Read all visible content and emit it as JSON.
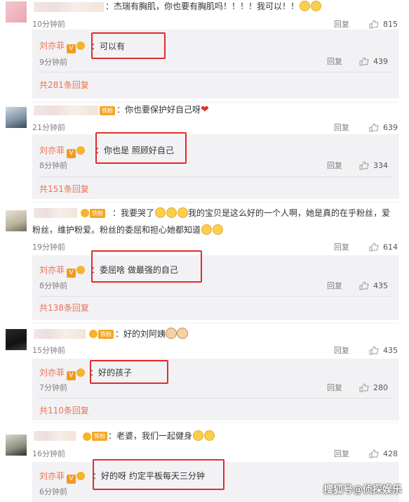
{
  "comments": [
    {
      "text": "：杰瑞有胸肌，你也要有胸肌吗！！！！我可以！！",
      "time": "10分钟前",
      "reply_label": "回复",
      "likes": "815",
      "reply": {
        "name": "刘亦菲",
        "text": "：可以有",
        "time": "9分钟前",
        "reply_label": "回复",
        "likes": "439"
      },
      "more": "共281条回复"
    },
    {
      "text": "：你也要保护好自己呀",
      "time": "21分钟前",
      "reply_label": "回复",
      "likes": "639",
      "reply": {
        "name": "刘亦菲",
        "text": "：你也是 照顾好自己",
        "time": "8分钟前",
        "reply_label": "回复",
        "likes": "334"
      },
      "more": "共151条回复"
    },
    {
      "text_line1_a": "：我要哭了",
      "text_line1_b": "我的宝贝是这么好的一个人啊，她是真的在乎粉丝，爱",
      "text_line2": "粉丝，维护粉爱。粉丝的委屈和担心她都知道",
      "time": "19分钟前",
      "reply_label": "回复",
      "likes": "614",
      "reply": {
        "name": "刘亦菲",
        "text": "：委屈啥 做最强的自己",
        "time": "8分钟前",
        "reply_label": "回复",
        "likes": "435"
      },
      "more": "共138条回复"
    },
    {
      "text": "：好的刘阿姨",
      "time": "15分钟前",
      "reply_label": "回复",
      "likes": "435",
      "reply": {
        "name": "刘亦菲",
        "text": "：好的孩子",
        "time": "7分钟前",
        "reply_label": "回复",
        "likes": "280"
      },
      "more": "共110条回复"
    },
    {
      "text": "：老婆，我们一起健身",
      "time": "16分钟前",
      "reply_label": "回复",
      "likes": "428",
      "reply": {
        "name": "刘亦菲",
        "text": "：好的呀 约定平板每天三分钟",
        "time": "6分钟前",
        "reply_label": "回复"
      }
    }
  ],
  "badges": {
    "v": "V",
    "fan": "铁粉"
  },
  "watermark": "搜狐号@侦探娱乐",
  "colors": {
    "name": "#eb7350",
    "highlight_box": "#e12b2b",
    "reply_bg": "#f2f2f5"
  }
}
